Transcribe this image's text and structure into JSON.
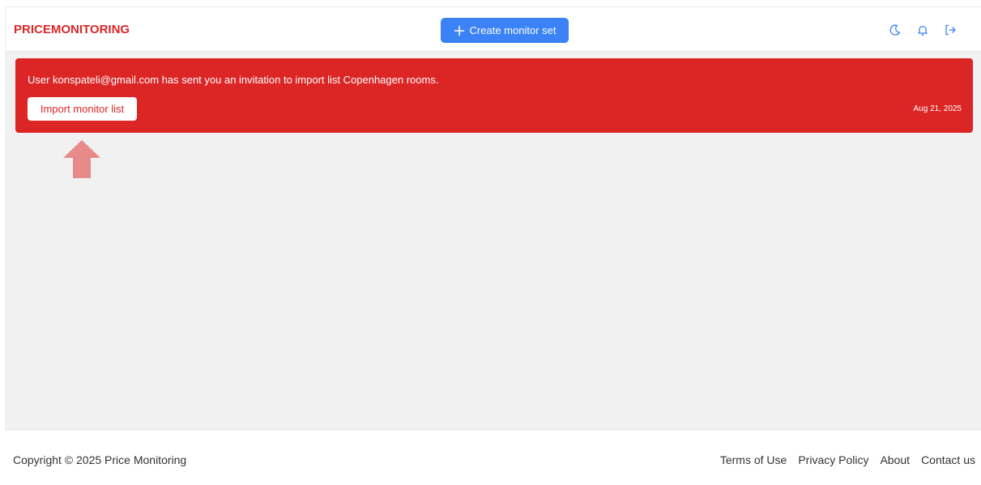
{
  "header": {
    "brand": "PRICEMONITORING",
    "create_button_label": "Create monitor set",
    "icons": [
      "moon-icon",
      "bell-icon",
      "logout-icon"
    ]
  },
  "notification": {
    "message": "User konspateli@gmail.com has sent you an invitation to import list Copenhagen rooms.",
    "import_button_label": "Import monitor list",
    "date": "Aug 21, 2025"
  },
  "footer": {
    "copyright": "Copyright © 2025 Price Monitoring",
    "links": [
      "Terms of Use",
      "Privacy Policy",
      "About",
      "Contact us"
    ]
  },
  "colors": {
    "brand": "#dc2626",
    "primary_button": "#3b82f6",
    "banner_bg": "#dc2626",
    "page_bg": "#f1f1f1",
    "arrow": "#e88a8a"
  }
}
